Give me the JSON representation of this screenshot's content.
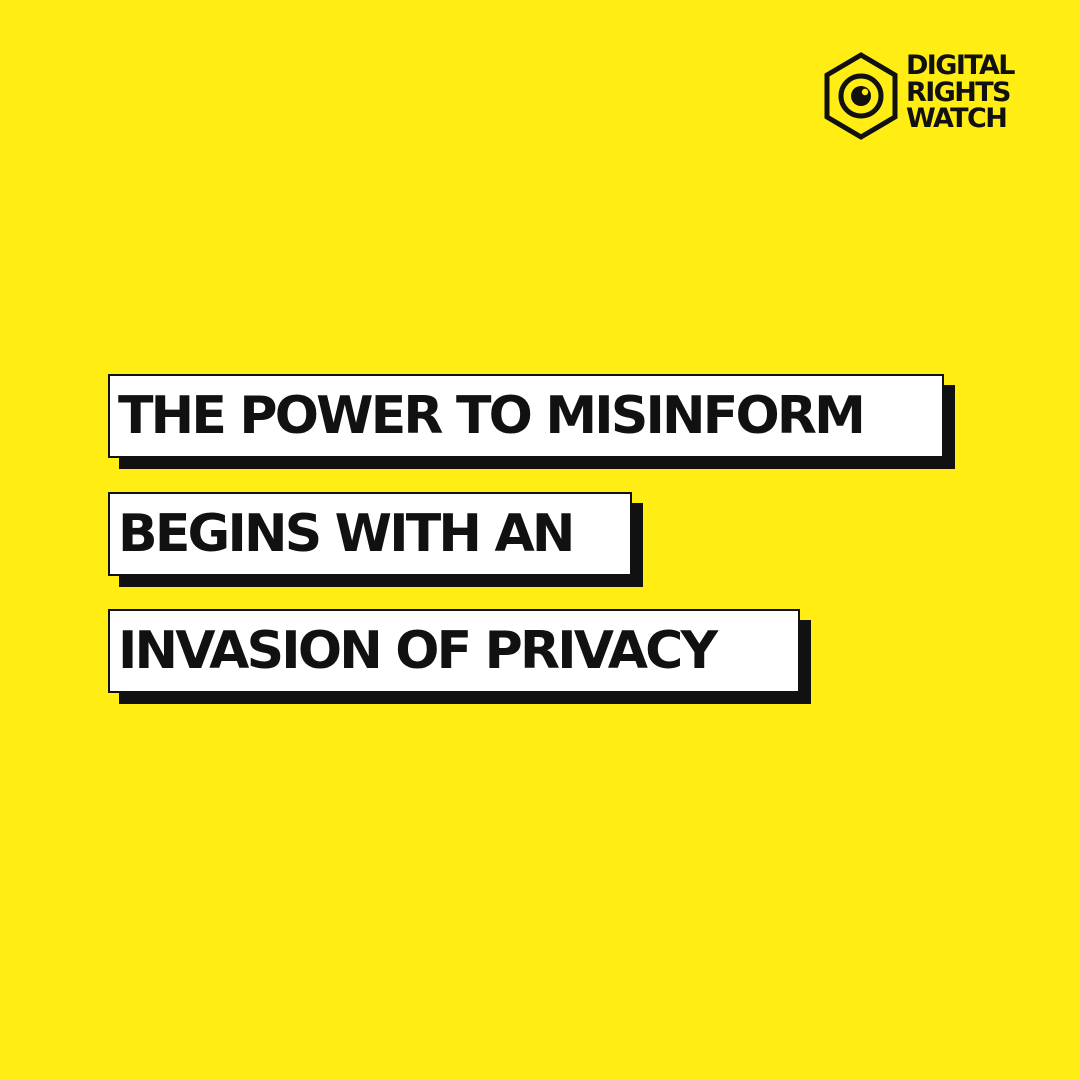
{
  "colors": {
    "background": "#FFED14",
    "ink": "#111111",
    "box": "#FFFFFF"
  },
  "logo": {
    "icon": "eye-hexagon-icon",
    "lines": [
      "DIGITAL",
      "RIGHTS",
      "WATCH"
    ]
  },
  "headline": {
    "lines": [
      "THE POWER TO MISINFORM",
      "BEGINS WITH AN",
      "INVASION OF PRIVACY"
    ]
  }
}
